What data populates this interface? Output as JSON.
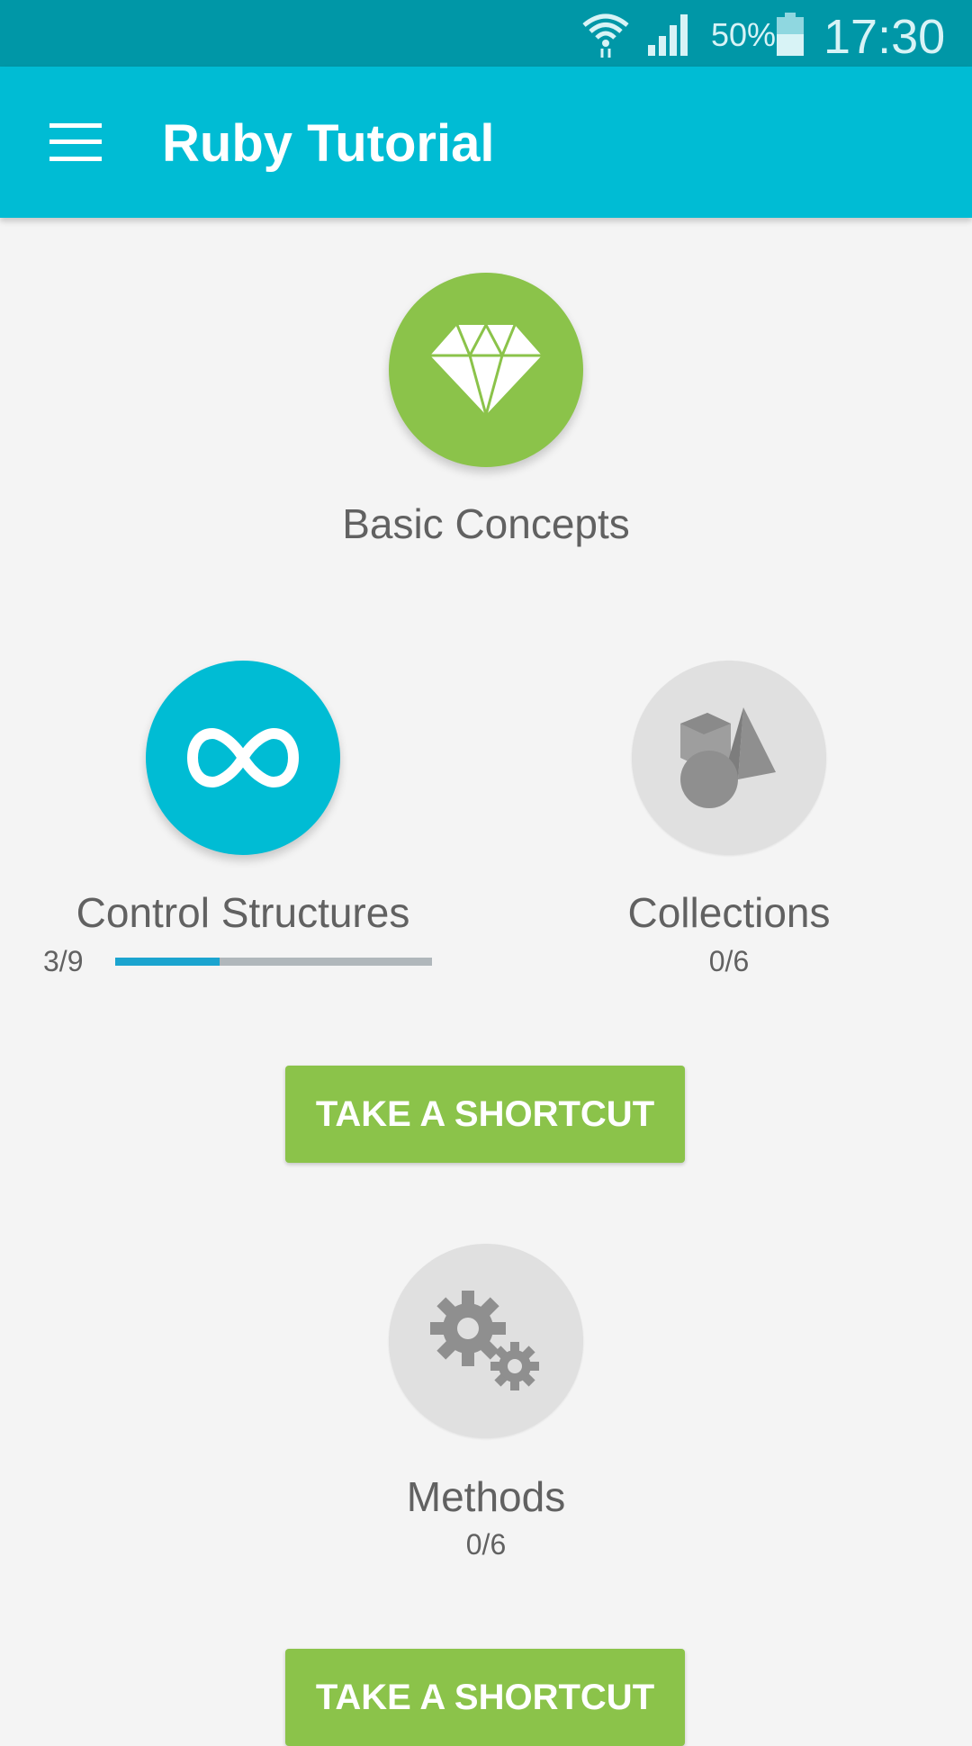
{
  "status_bar": {
    "battery": "50%",
    "time": "17:30",
    "icons": [
      "wifi-icon",
      "signal-icon",
      "battery-icon"
    ]
  },
  "app_bar": {
    "title": "Ruby Tutorial",
    "menu_icon": "hamburger-menu-icon"
  },
  "modules": {
    "basic": {
      "label": "Basic Concepts",
      "icon": "diamond-icon",
      "color": "#8bc34a"
    },
    "control": {
      "label": "Control Structures",
      "icon": "infinity-icon",
      "color": "#00bcd4",
      "progress_text": "3/9",
      "progress": 0.33
    },
    "collections": {
      "label": "Collections",
      "icon": "shapes-icon",
      "progress_text": "0/6"
    },
    "methods": {
      "label": "Methods",
      "icon": "gears-icon",
      "progress_text": "0/6"
    }
  },
  "shortcut_label": "TAKE A SHORTCUT",
  "colors": {
    "status_bar": "#0097a7",
    "app_bar": "#00bcd4",
    "accent_green": "#8bc34a",
    "progress_blue": "#1ba4cf",
    "locked_grey": "#e0e0e0"
  }
}
